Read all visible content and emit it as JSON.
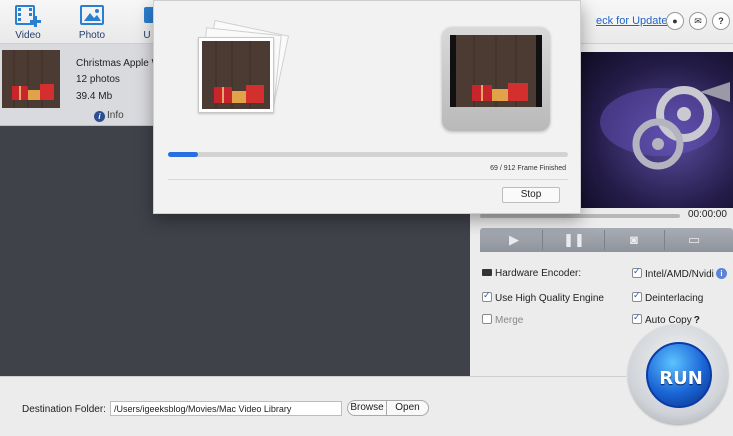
{
  "toolbar": {
    "video_label": "Video",
    "photo_label": "Photo",
    "partial_label": "U",
    "check_updates": "eck for Updates"
  },
  "file": {
    "title": "Christmas Apple Wat",
    "count": "12 photos",
    "size": "39.4 Mb",
    "info_label": "Info"
  },
  "player": {
    "time": "00:00:00"
  },
  "options": {
    "hardware_encoder": "Hardware Encoder:",
    "intel": "Intel/AMD/Nvidi",
    "high_quality": "Use High Quality Engine",
    "deinterlacing": "Deinterlacing",
    "merge": "Merge",
    "auto_copy": "Auto Copy",
    "help_mark": "?"
  },
  "run": {
    "label": "RUN"
  },
  "destination": {
    "label": "Destination Folder:",
    "path": "/Users/igeeksblog/Movies/Mac Video Library",
    "browse": "Browse",
    "open": "Open"
  },
  "dialog": {
    "frames_done": 69,
    "frames_total": 912,
    "frames_text": "69 / 912 Frame Finished",
    "stop_label": "Stop"
  },
  "colors": {
    "accent": "#2a6fe0",
    "link": "#1f63c6",
    "run_blue": "#1a64d6"
  }
}
